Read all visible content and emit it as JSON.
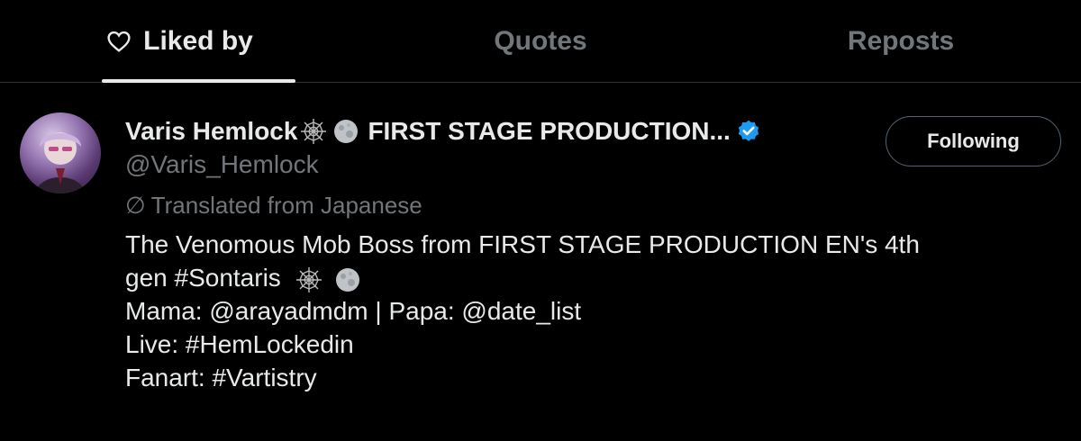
{
  "tabs": [
    {
      "label": "Liked by",
      "active": true,
      "icon": "heart-icon"
    },
    {
      "label": "Quotes",
      "active": false
    },
    {
      "label": "Reposts",
      "active": false
    }
  ],
  "user": {
    "display_name": "Varis Hemlock",
    "name_suffix": "FIRST STAGE PRODUCTION...",
    "name_emojis": [
      "spiderweb-icon",
      "moon-icon"
    ],
    "verified": true,
    "handle": "@Varis_Hemlock",
    "translated_label": "Translated from Japanese",
    "follow_button": "Following",
    "bio_lines": [
      "The Venomous Mob Boss from FIRST STAGE PRODUCTION EN's 4th",
      "gen #Sontaris",
      "Mama: @arayadmdm | Papa: @date_list",
      "Live: #HemLockedin",
      "Fanart: #Vartistry"
    ]
  },
  "colors": {
    "background": "#000000",
    "text_primary": "#e7e9ea",
    "text_secondary": "#71767b",
    "verified_blue": "#1d9bf0",
    "border": "#2f3336"
  }
}
